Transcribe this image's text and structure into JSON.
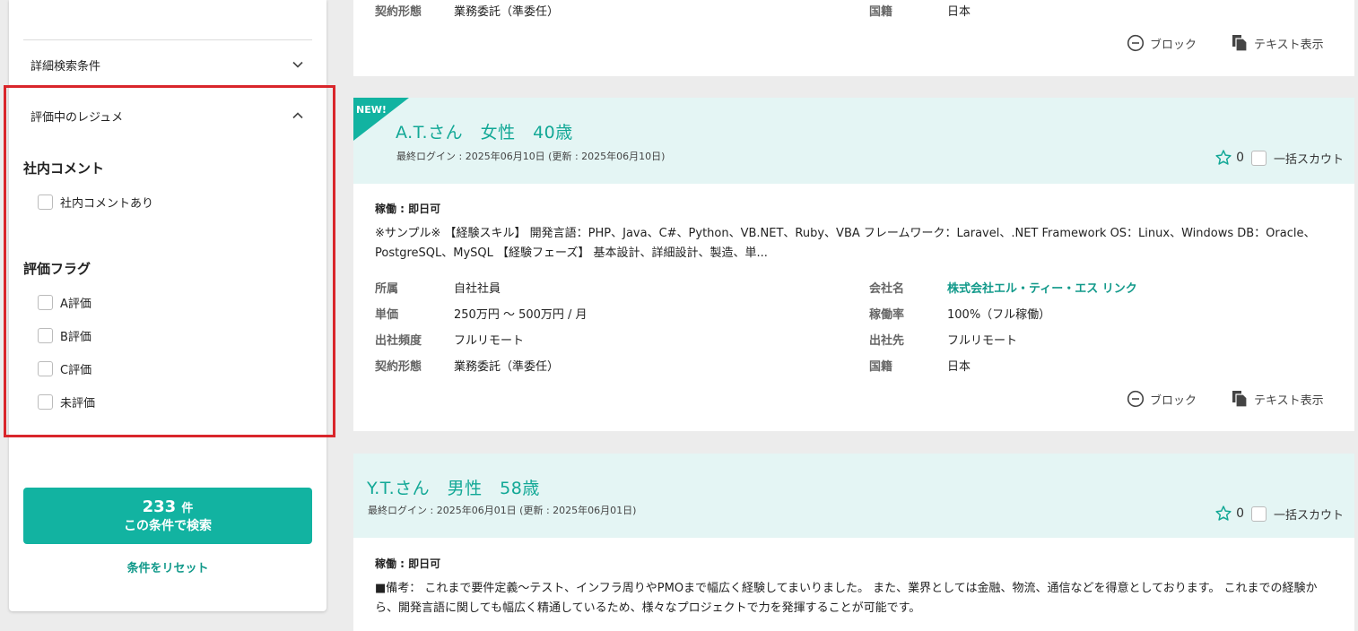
{
  "sidebar": {
    "detail_search": "詳細検索条件",
    "resume_section": "評価中のレジュメ",
    "internal_comment": {
      "heading": "社内コメント",
      "option": "社内コメントあり"
    },
    "eval_flag": {
      "heading": "評価フラグ",
      "options": [
        "A評価",
        "B評価",
        "C評価",
        "未評価"
      ]
    },
    "search_button": {
      "count": "233",
      "unit": "件",
      "label": "この条件で検索"
    },
    "reset_label": "条件をリセット"
  },
  "top_card": {
    "fields": {
      "contract_label": "契約形態",
      "contract_value": "業務委託（準委任）",
      "nationality_label": "国籍",
      "nationality_value": "日本"
    },
    "block_label": "ブロック",
    "text_label": "テキスト表示"
  },
  "card1": {
    "badge": "NEW!",
    "name": "A.T.さん　女性　40歳",
    "login": "最終ログイン : 2025年06月10日 (更新 : 2025年06月10日)",
    "fav_count": "0",
    "scout_label": "一括スカウト",
    "availability": "稼働 : 即日可",
    "description": "※サンプル※ 【経験スキル】 開発言語：PHP、Java、C#、Python、VB.NET、Ruby、VBA フレームワーク：Laravel、.NET Framework OS：Linux、Windows DB：Oracle、PostgreSQL、MySQL 【経験フェーズ】 基本設計、詳細設計、製造、単...",
    "fields": {
      "affiliation_label": "所属",
      "affiliation_value": "自社社員",
      "price_label": "単価",
      "price_value": "250万円 ～ 500万円 / 月",
      "office_freq_label": "出社頻度",
      "office_freq_value": "フルリモート",
      "contract_label": "契約形態",
      "contract_value": "業務委託（準委任）",
      "company_label": "会社名",
      "company_value": "株式会社エル・ティー・エス リンク",
      "rate_label": "稼働率",
      "rate_value": "100%（フル稼働）",
      "office_label": "出社先",
      "office_value": "フルリモート",
      "nationality_label": "国籍",
      "nationality_value": "日本"
    },
    "block_label": "ブロック",
    "text_label": "テキスト表示"
  },
  "card2": {
    "name": "Y.T.さん　男性　58歳",
    "login": "最終ログイン : 2025年06月01日 (更新 : 2025年06月01日)",
    "fav_count": "0",
    "scout_label": "一括スカウト",
    "availability": "稼働 : 即日可",
    "description": "■備考： これまで要件定義～テスト、インフラ周りやPMOまで幅広く経験してまいりました。 また、業界としては金融、物流、通信などを得意としております。 これまでの経験から、開発言語に関しても幅広く精通しているため、様々なプロジェクトで力を発揮することが可能です。"
  },
  "colors": {
    "accent": "#12b3a1",
    "header_bg": "#e4f5f4",
    "highlight": "#d9262b"
  }
}
